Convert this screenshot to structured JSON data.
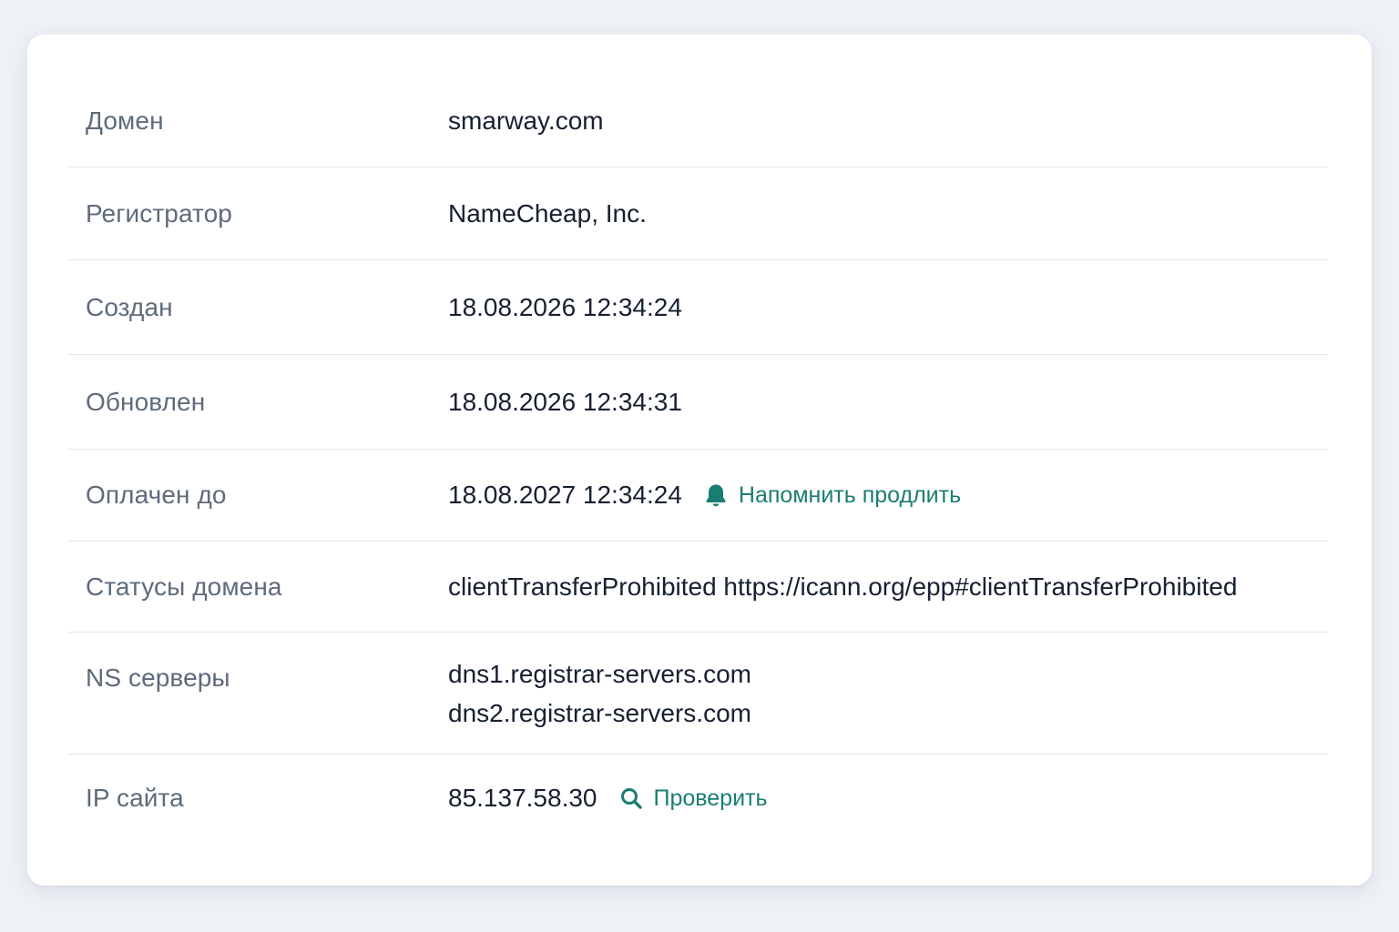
{
  "rows": {
    "domain": {
      "label": "Домен",
      "value": "smarway.com"
    },
    "registrar": {
      "label": "Регистратор",
      "value": "NameCheap, Inc."
    },
    "created": {
      "label": "Создан",
      "value": "18.08.2026 12:34:24"
    },
    "updated": {
      "label": "Обновлен",
      "value": "18.08.2026 12:34:31"
    },
    "paid_until": {
      "label": "Оплачен до",
      "value": "18.08.2027 12:34:24",
      "action_label": "Напомнить продлить",
      "action_icon": "bell-icon"
    },
    "statuses": {
      "label": "Статусы домена",
      "value": "clientTransferProhibited https://icann.org/epp#clientTransferProhibited"
    },
    "ns": {
      "label": "NS серверы",
      "values": [
        "dns1.registrar-servers.com",
        "dns2.registrar-servers.com"
      ]
    },
    "ip": {
      "label": "IP сайта",
      "value": "85.137.58.30",
      "action_label": "Проверить",
      "action_icon": "search-icon"
    }
  },
  "colors": {
    "accent": "#1a7d72",
    "label_text": "#5d6b7c",
    "value_text": "#162031",
    "divider": "#e3e7ec",
    "background": "#eef2f7",
    "card": "#ffffff"
  }
}
